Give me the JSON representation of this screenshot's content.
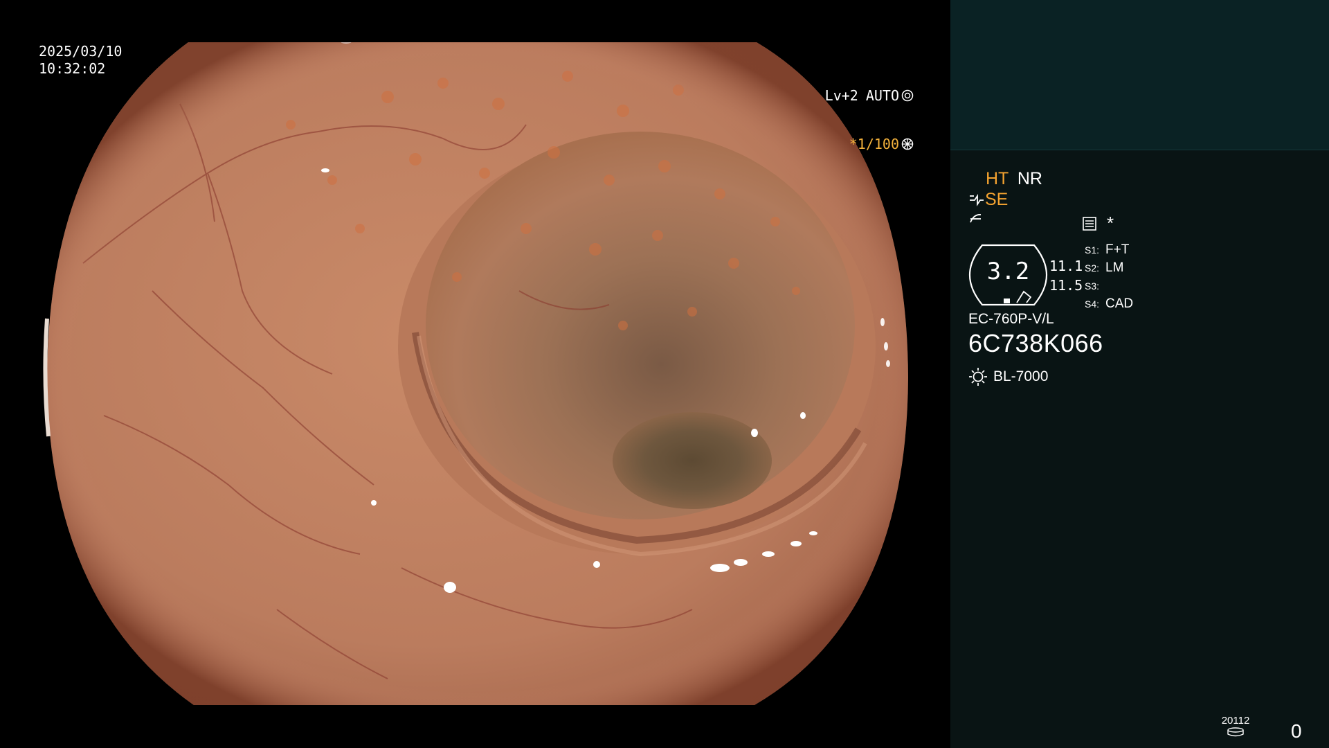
{
  "overlay": {
    "date": "2025/03/10",
    "time": "10:32:02",
    "shutter": "*1/100",
    "level": "Lv+2",
    "iris_mode": "AUTO"
  },
  "panel": {
    "ht": "HT",
    "nr": "NR",
    "se": "SE",
    "settings_mark": "*",
    "gauge_value": "3.2",
    "scale_values": [
      "11.1",
      "11.5"
    ],
    "switches": [
      {
        "label": "S1:",
        "value": "F+T"
      },
      {
        "label": "S2:",
        "value": "LM"
      },
      {
        "label": "S3:",
        "value": ""
      },
      {
        "label": "S4:",
        "value": "CAD"
      }
    ],
    "scope_model": "EC-760P-V/L",
    "scope_serial": "6C738K066",
    "light_source": "BL-7000",
    "disk_number": "20112",
    "counter": "0"
  },
  "colors": {
    "accent_orange": "#f4a330",
    "panel_bg": "#091414",
    "panel_top_bg": "#0a2224"
  }
}
